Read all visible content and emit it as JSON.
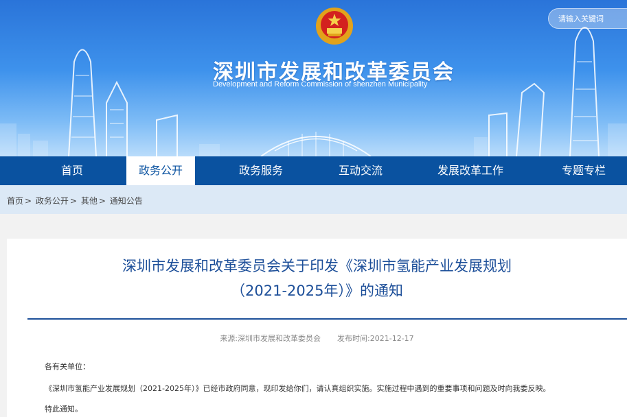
{
  "header": {
    "title": "深圳市发展和改革委员会",
    "subtitle": "Development and Reform Commission of shenzhen Municipality",
    "emblem_icon": "national-emblem-icon",
    "search_placeholder": "请输入关键词"
  },
  "nav": {
    "items": [
      {
        "label": "首页",
        "active": false
      },
      {
        "label": "政务公开",
        "active": true
      },
      {
        "label": "政务服务",
        "active": false
      },
      {
        "label": "互动交流",
        "active": false
      },
      {
        "label": "发展改革工作",
        "active": false
      },
      {
        "label": "专题专栏",
        "active": false
      }
    ],
    "bg_color": "#0a52a0"
  },
  "breadcrumb": {
    "items": [
      "首页",
      "政务公开",
      "其他",
      "通知公告"
    ],
    "separator": ">"
  },
  "article": {
    "title_line1": "深圳市发展和改革委员会关于印发《深圳市氢能产业发展规划",
    "title_line2": "（2021-2025年）》的通知",
    "source_label": "来源:",
    "source": "深圳市发展和改革委员会",
    "date_label": "发布时间:",
    "date": "2021-12-17",
    "salutation": "各有关单位：",
    "body": "《深圳市氢能产业发展规划（2021-2025年）》已经市政府同意，现印发给你们，请认真组织实施。实施过程中遇到的重要事项和问题及时向我委反映。",
    "closing": "特此通知。"
  },
  "colors": {
    "title_blue": "#1d4f99",
    "crumb_bg": "#dce9f6"
  }
}
